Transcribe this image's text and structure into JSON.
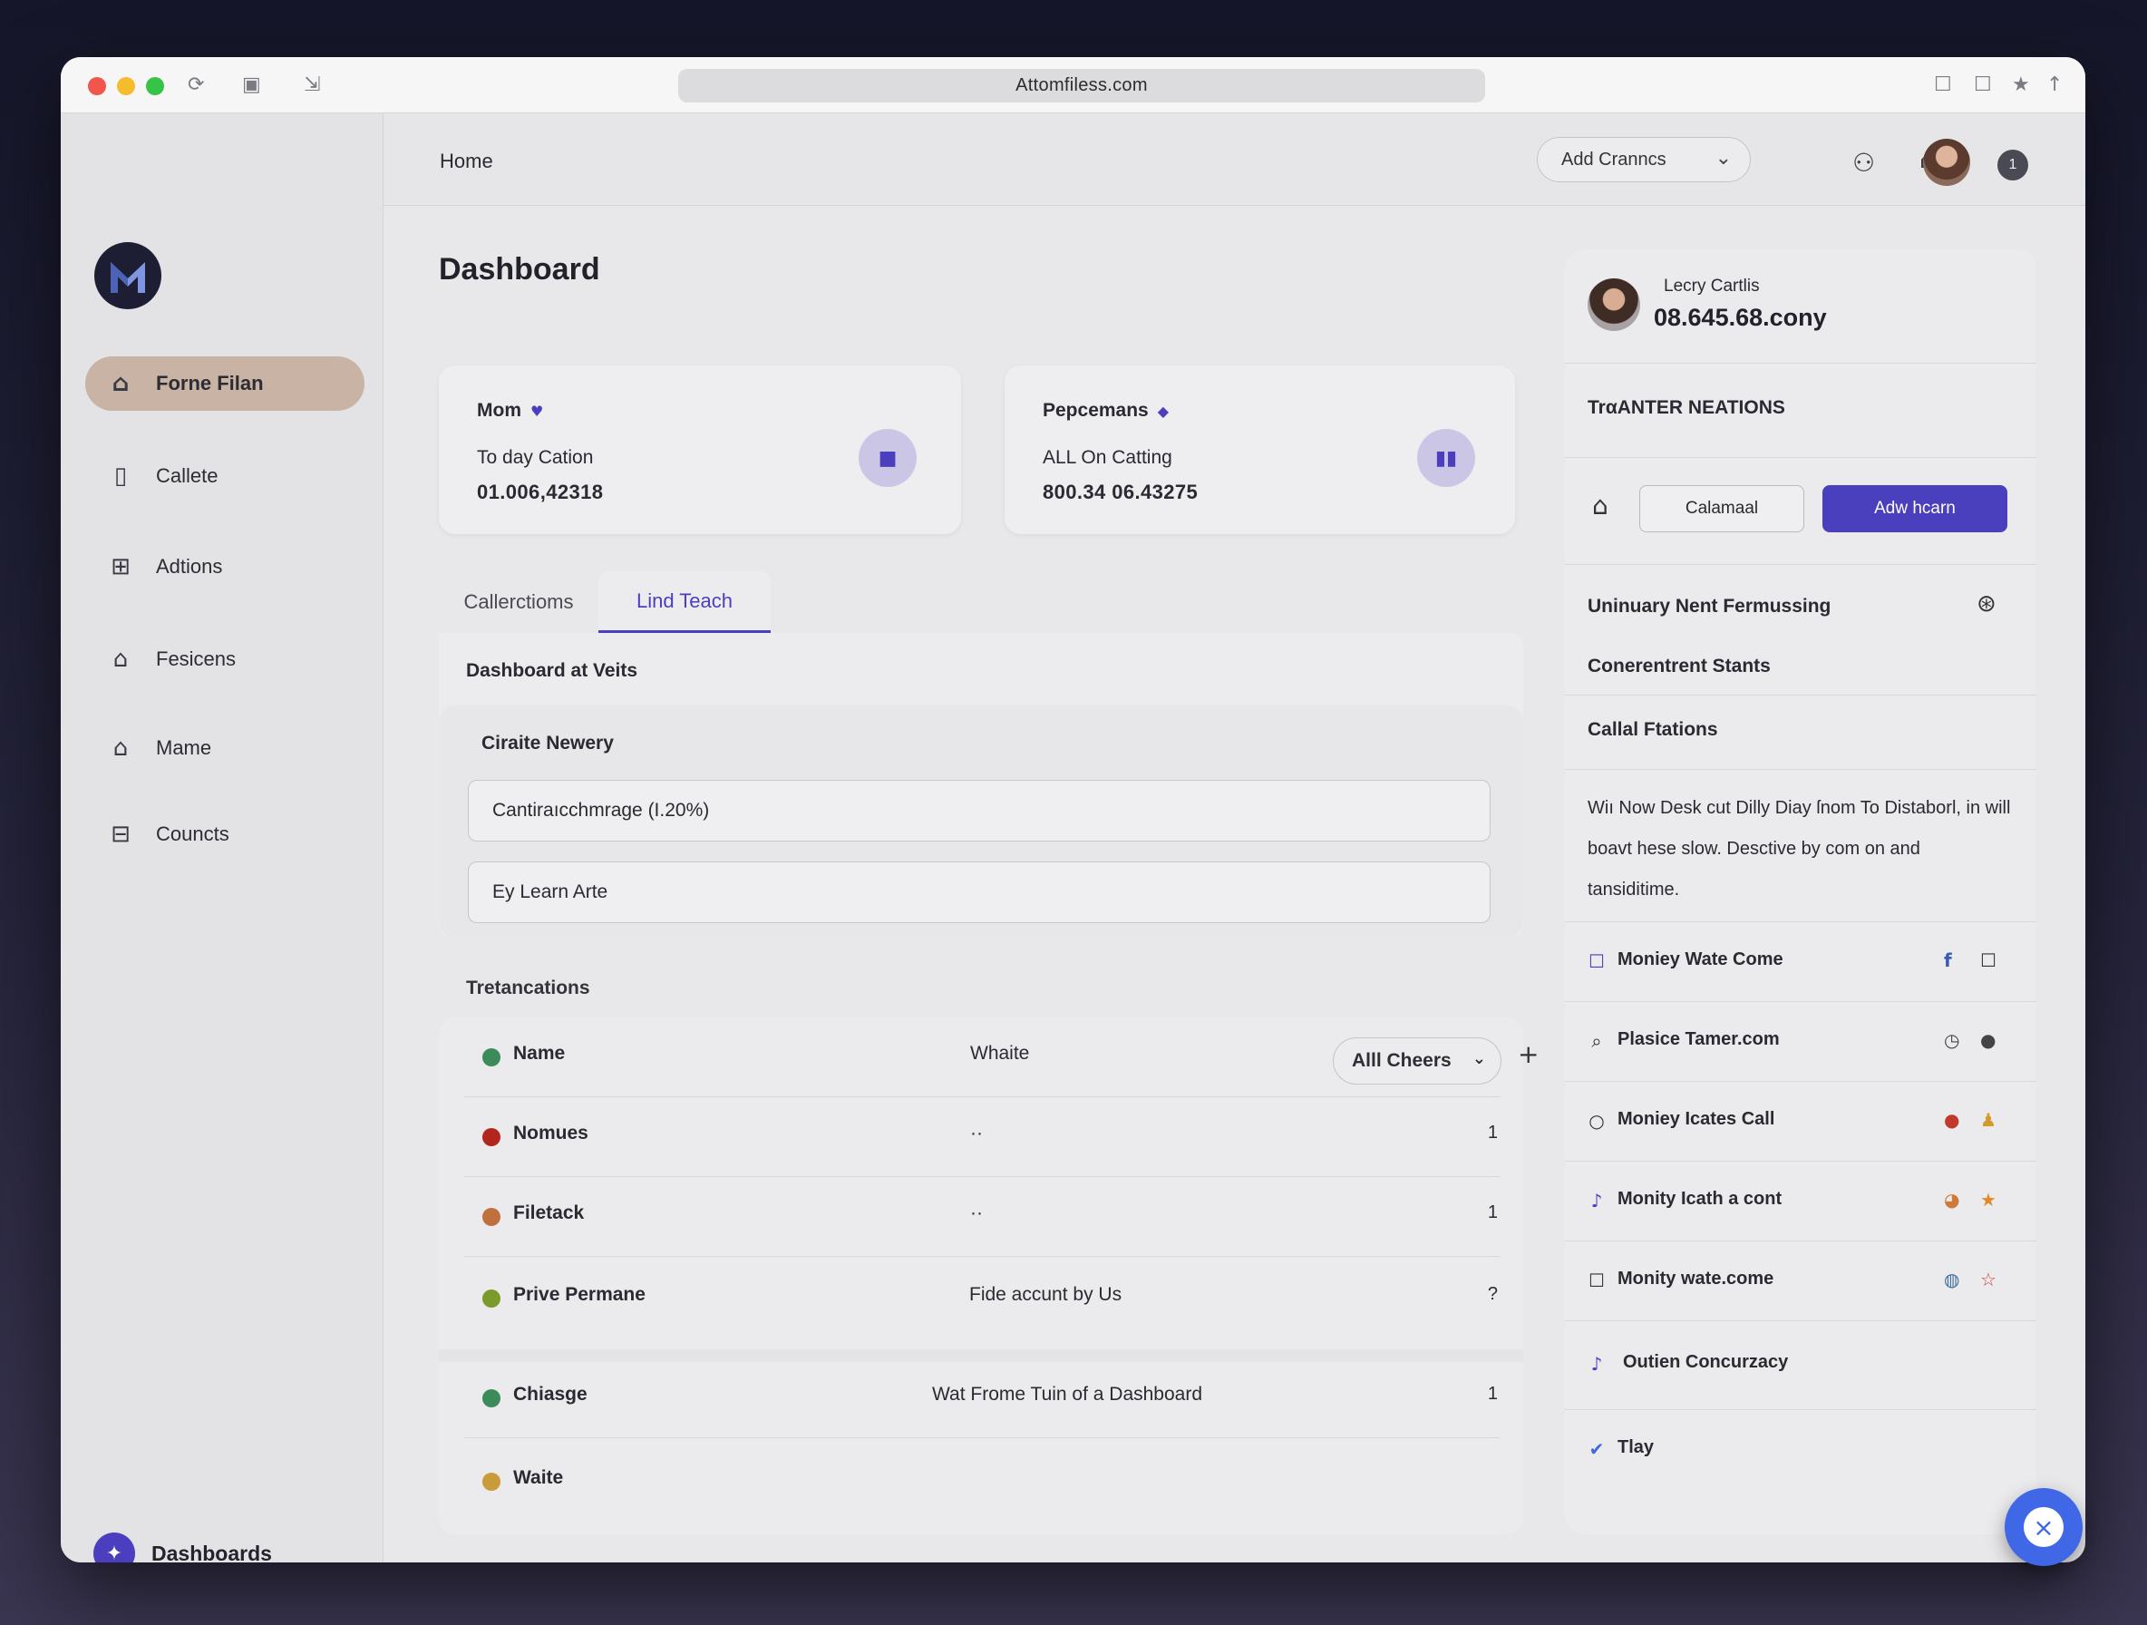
{
  "browser": {
    "url": "Attomfiless.com"
  },
  "sidebar": {
    "items": [
      {
        "label": "Forne Filan",
        "icon": "home-icon",
        "active": true
      },
      {
        "label": "Callete",
        "icon": "document-icon"
      },
      {
        "label": "Adtions",
        "icon": "grid-icon"
      },
      {
        "label": "Fesicens",
        "icon": "house-fill-icon"
      },
      {
        "label": "Mame",
        "icon": "home-outline-icon"
      },
      {
        "label": "Councts",
        "icon": "chair-icon"
      }
    ],
    "footer_label": "Dashboards"
  },
  "header": {
    "breadcrumb": "Home",
    "add_button": "Add Cranncs",
    "notification_count": "1"
  },
  "main": {
    "title": "Dashboard",
    "cards": [
      {
        "heading": "Mom",
        "subtitle": "To day Cation",
        "value": "01.006,42318",
        "icon": "camera-icon"
      },
      {
        "heading": "Pepcemans",
        "subtitle": "ALL On Catting",
        "value": "800.34 06.43275",
        "icon": "bar-chart-icon"
      }
    ],
    "tabs": [
      {
        "label": "Callerctioms",
        "active": false
      },
      {
        "label": "Lind Teach",
        "active": true
      }
    ],
    "panel_title": "Dashboard at Veits",
    "subpanel_title": "Ciraite Newery",
    "fields": [
      "Cantiraıcchmrage (I.20%)",
      "Ey  Learn Arte"
    ],
    "transactions_label": "Tretancations",
    "table": {
      "header": {
        "name": "Name",
        "mid": "Whaite",
        "filter": "Alll Cheers"
      },
      "rows": [
        {
          "name": "Nomues",
          "mid": "··",
          "num": "1",
          "color": "#b3261e"
        },
        {
          "name": "Filetack",
          "mid": "··",
          "num": "1",
          "color": "#c0703f"
        },
        {
          "name": "Prive Permane",
          "mid": "Fide accunt by Us",
          "num": "?",
          "color": "#7a9a2a"
        },
        {
          "name": "Chiasge",
          "mid": "Wat Frome Tuin of a Dashboard",
          "num": "1",
          "color": "#3c8b5a"
        },
        {
          "name": "Waite",
          "mid": "",
          "num": "",
          "color": "#c99b3a"
        }
      ]
    }
  },
  "right_panel": {
    "user_name": "Lecry Cartlis",
    "user_value": "08.645.68.cony",
    "section_title": "TrαANTER NEATIONS",
    "btn_secondary": "Calamaal",
    "btn_primary": "Adw hcarn",
    "line1": "Uninuary Nent Fermussing",
    "line2": "Conerentrent Stants",
    "line3": "Callal Ftations",
    "description": "Wiı Now Desk cut Dilly Diay ſnom To Distaborl, in will boavt hese slow. Desctive by com on and tansiditime.",
    "items": [
      {
        "label": "Moniey Wate Come",
        "icon": "checkbox-icon",
        "a": "facebook-icon",
        "b": "square-icon"
      },
      {
        "label": "Plasice Tamer.com",
        "icon": "search-icon",
        "a": "clock-icon",
        "b": "user-icon"
      },
      {
        "label": "Moniey Icates Call",
        "icon": "circle-icon",
        "a": "pin-icon",
        "b": "person-icon"
      },
      {
        "label": "Monity Icath a cont",
        "icon": "music-icon",
        "a": "palette-icon",
        "b": "star-icon"
      },
      {
        "label": "Monity wate.come",
        "icon": "checkbox-icon",
        "a": "globe-icon",
        "b": "star-outline-icon"
      },
      {
        "label": "Outien Concurzacy",
        "icon": "music-icon",
        "a": "",
        "b": ""
      },
      {
        "label": "Tlay",
        "icon": "check-circle-icon",
        "a": "",
        "b": ""
      }
    ]
  },
  "colors": {
    "accent": "#4a3fbd",
    "active_nav": "#c9b3a4",
    "fab": "#3f67e6"
  }
}
